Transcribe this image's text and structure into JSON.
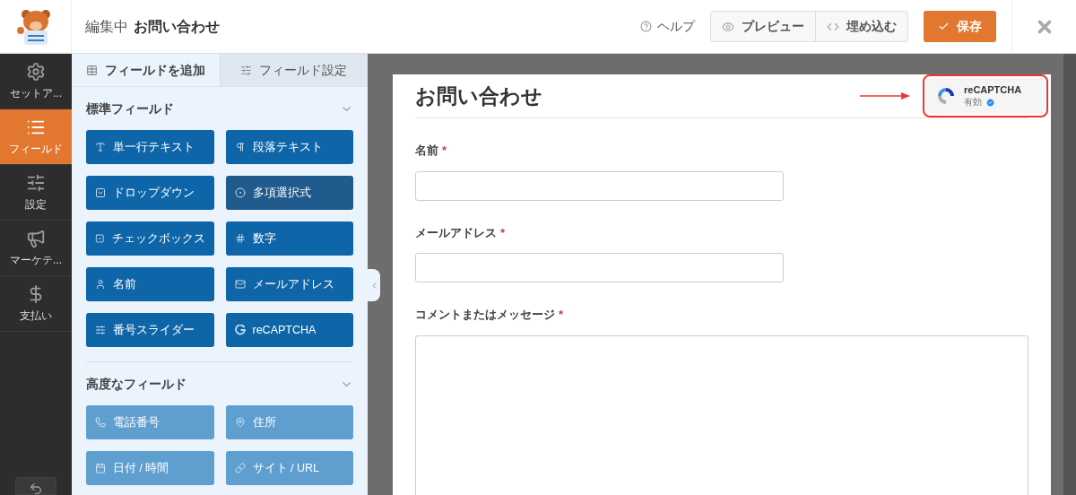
{
  "header": {
    "editing_label": "編集中",
    "form_name": "お問い合わせ",
    "help": "ヘルプ",
    "preview": "プレビュー",
    "embed": "埋め込む",
    "save": "保存"
  },
  "nav": [
    {
      "label": "セットア...",
      "selected": false
    },
    {
      "label": "フィールド",
      "selected": true
    },
    {
      "label": "設定",
      "selected": false
    },
    {
      "label": "マーケテ...",
      "selected": false
    },
    {
      "label": "支払い",
      "selected": false
    }
  ],
  "panel_tabs": [
    {
      "label": "フィールドを追加",
      "selected": true
    },
    {
      "label": "フィールド設定",
      "selected": false
    }
  ],
  "sections": [
    {
      "title": "標準フィールド",
      "fields": [
        {
          "label": "単一行テキスト",
          "disabled": false,
          "highlighted": false
        },
        {
          "label": "段落テキスト",
          "disabled": false,
          "highlighted": false
        },
        {
          "label": "ドロップダウン",
          "disabled": false,
          "highlighted": false
        },
        {
          "label": "多項選択式",
          "disabled": false,
          "highlighted": true
        },
        {
          "label": "チェックボックス",
          "disabled": false,
          "highlighted": false
        },
        {
          "label": "数字",
          "disabled": false,
          "highlighted": false
        },
        {
          "label": "名前",
          "disabled": false,
          "highlighted": false
        },
        {
          "label": "メールアドレス",
          "disabled": false,
          "highlighted": false
        },
        {
          "label": "番号スライダー",
          "disabled": false,
          "highlighted": false
        },
        {
          "label": "reCAPTCHA",
          "disabled": false,
          "highlighted": false
        }
      ]
    },
    {
      "title": "高度なフィールド",
      "fields": [
        {
          "label": "電話番号",
          "disabled": true
        },
        {
          "label": "住所",
          "disabled": true
        },
        {
          "label": "日付 / 時間",
          "disabled": true
        },
        {
          "label": "サイト / URL",
          "disabled": true
        }
      ]
    }
  ],
  "form": {
    "title": "お問い合わせ",
    "recaptcha": {
      "name": "reCAPTCHA",
      "status": "有効"
    },
    "fields": [
      {
        "label": "名前",
        "required_mark": "*",
        "kind": "input"
      },
      {
        "label": "メールアドレス",
        "required_mark": "*",
        "kind": "input"
      },
      {
        "label": "コメントまたはメッセージ",
        "required_mark": "*",
        "kind": "textarea"
      }
    ]
  }
}
